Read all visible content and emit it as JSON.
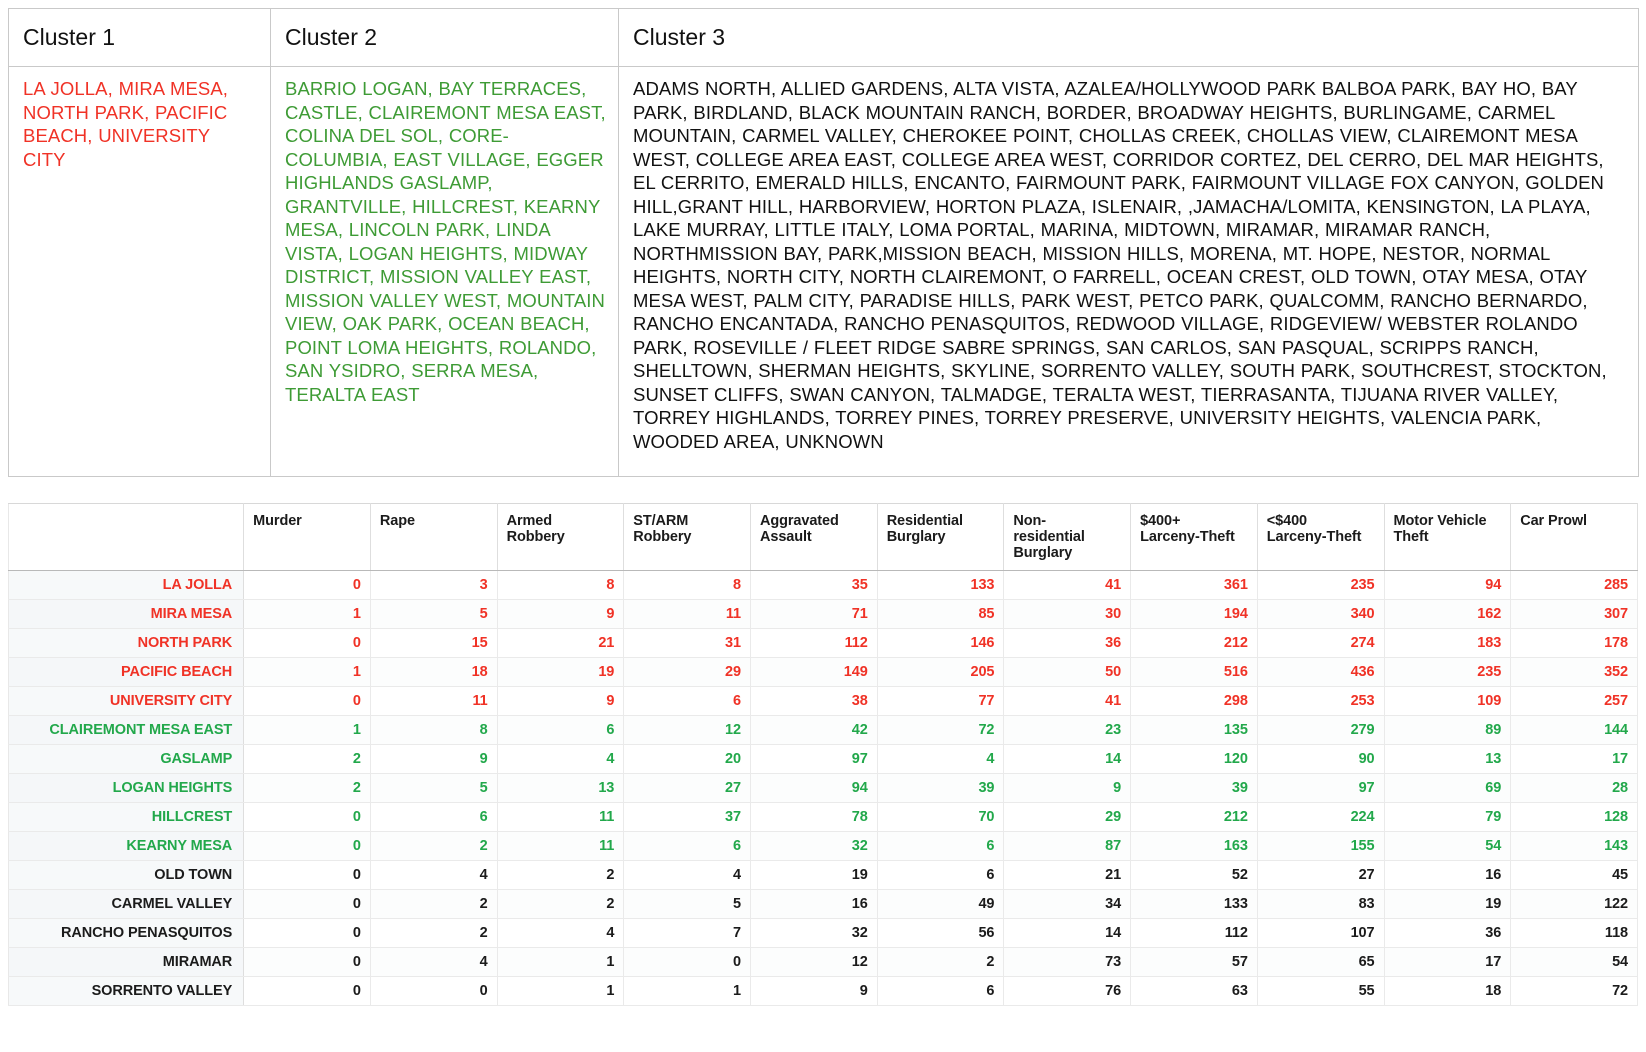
{
  "clusters": {
    "headers": [
      "Cluster 1",
      "Cluster 2",
      "Cluster 3"
    ],
    "colors": {
      "cluster1": "#F03226",
      "cluster2": "#3E9B35",
      "cluster3": "#111111"
    },
    "cluster1_text": "LA JOLLA, MIRA MESA, NORTH PARK, PACIFIC BEACH, UNIVERSITY CITY",
    "cluster2_text": "BARRIO LOGAN, BAY TERRACES, CASTLE,  CLAIREMONT MESA EAST, COLINA DEL SOL, CORE-COLUMBIA, EAST VILLAGE, EGGER HIGHLANDS GASLAMP, GRANTVILLE,  HILLCREST, KEARNY MESA,  LINCOLN PARK, LINDA VISTA,  LOGAN HEIGHTS, MIDWAY DISTRICT, MISSION VALLEY EAST,  MISSION VALLEY WEST,  MOUNTAIN VIEW, OAK PARK, OCEAN BEACH,  POINT LOMA HEIGHTS,  ROLANDO, SAN YSIDRO, SERRA MESA, TERALTA EAST",
    "cluster3_text": "ADAMS NORTH, ALLIED GARDENS,  ALTA VISTA, AZALEA/HOLLYWOOD PARK BALBOA PARK, BAY HO, BAY PARK, BIRDLAND,  BLACK MOUNTAIN RANCH, BORDER,  BROADWAY HEIGHTS, BURLINGAME, CARMEL MOUNTAIN, CARMEL VALLEY, CHEROKEE POINT,  CHOLLAS CREEK, CHOLLAS VIEW, CLAIREMONT MESA WEST, COLLEGE AREA EAST,  COLLEGE AREA WEST, CORRIDOR CORTEZ,  DEL CERRO,  DEL MAR HEIGHTS, EL CERRITO, EMERALD HILLS, ENCANTO, FAIRMOUNT PARK, FAIRMOUNT VILLAGE  FOX CANYON, GOLDEN HILL,GRANT HILL, HARBORVIEW, HORTON PLAZA, ISLENAIR, ,JAMACHA/LOMITA, KENSINGTON, LA PLAYA, LAKE MURRAY, LITTLE ITALY, LOMA PORTAL, MARINA, MIDTOWN, MIRAMAR, MIRAMAR RANCH, NORTHMISSION BAY, PARK,MISSION BEACH, MISSION HILLS, MORENA,  MT. HOPE, NESTOR, NORMAL HEIGHTS, NORTH CITY, NORTH CLAIREMONT, O FARRELL, OCEAN CREST, OLD TOWN, OTAY MESA, OTAY MESA WEST,  PALM CITY, PARADISE HILLS, PARK WEST,  PETCO PARK, QUALCOMM, RANCHO BERNARDO, RANCHO ENCANTADA, RANCHO PENASQUITOS, REDWOOD VILLAGE, RIDGEVIEW/ WEBSTER  ROLANDO PARK, ROSEVILLE / FLEET RIDGE SABRE SPRINGS, SAN CARLOS, SAN PASQUAL, SCRIPPS RANCH, SHELLTOWN, SHERMAN HEIGHTS, SKYLINE, SORRENTO VALLEY, SOUTH PARK, SOUTHCREST, STOCKTON, SUNSET CLIFFS, SWAN CANYON, TALMADGE, TERALTA WEST,   TIERRASANTA, TIJUANA RIVER VALLEY, TORREY HIGHLANDS, TORREY PINES, TORREY PRESERVE, UNIVERSITY HEIGHTS, VALENCIA PARK, WOODED AREA, UNKNOWN"
  },
  "chart_data": {
    "type": "table",
    "title": "",
    "row_header_label": "",
    "categories": [
      "Murder",
      "Rape",
      "Armed Robbery",
      "ST/ARM Robbery",
      "Aggravated Assault",
      "Residential Burglary",
      "Non-residential Burglary",
      "$400+ Larceny-Theft",
      "<$400 Larceny-Theft",
      "Motor Vehicle Theft",
      "Car Prowl"
    ],
    "column_headers": [
      {
        "line1": "",
        "line2": "",
        "line3": ""
      },
      {
        "line1": "Murder",
        "line2": "",
        "line3": ""
      },
      {
        "line1": "Rape",
        "line2": "",
        "line3": ""
      },
      {
        "line1": "Armed",
        "line2": "Robbery",
        "line3": ""
      },
      {
        "line1": "ST/ARM",
        "line2": "Robbery",
        "line3": ""
      },
      {
        "line1": "Aggravated",
        "line2": "Assault",
        "line3": ""
      },
      {
        "line1": "Residential",
        "line2": "Burglary",
        "line3": ""
      },
      {
        "line1": "Non-",
        "line2": "residential",
        "line3": "Burglary"
      },
      {
        "line1": "$400+",
        "line2": "Larceny-Theft",
        "line3": ""
      },
      {
        "line1": "<$400",
        "line2": "Larceny-Theft",
        "line3": ""
      },
      {
        "line1": "Motor Vehicle",
        "line2": "Theft",
        "line3": ""
      },
      {
        "line1": "Car Prowl",
        "line2": "",
        "line3": ""
      }
    ],
    "colors": {
      "cluster1": "#F03226",
      "cluster2": "#22A84B",
      "cluster3": "#1b1b1b"
    },
    "rows": [
      {
        "name": "LA JOLLA",
        "color": "red",
        "values": [
          0,
          3,
          8,
          8,
          35,
          133,
          41,
          361,
          235,
          94,
          285
        ]
      },
      {
        "name": "MIRA MESA",
        "color": "red",
        "values": [
          1,
          5,
          9,
          11,
          71,
          85,
          30,
          194,
          340,
          162,
          307
        ]
      },
      {
        "name": "NORTH PARK",
        "color": "red",
        "values": [
          0,
          15,
          21,
          31,
          112,
          146,
          36,
          212,
          274,
          183,
          178
        ]
      },
      {
        "name": "PACIFIC BEACH",
        "color": "red",
        "values": [
          1,
          18,
          19,
          29,
          149,
          205,
          50,
          516,
          436,
          235,
          352
        ]
      },
      {
        "name": "UNIVERSITY CITY",
        "color": "red",
        "values": [
          0,
          11,
          9,
          6,
          38,
          77,
          41,
          298,
          253,
          109,
          257
        ]
      },
      {
        "name": "CLAIREMONT MESA EAST",
        "color": "green",
        "values": [
          1,
          8,
          6,
          12,
          42,
          72,
          23,
          135,
          279,
          89,
          144
        ]
      },
      {
        "name": "GASLAMP",
        "color": "green",
        "values": [
          2,
          9,
          4,
          20,
          97,
          4,
          14,
          120,
          90,
          13,
          17
        ]
      },
      {
        "name": "LOGAN HEIGHTS",
        "color": "green",
        "values": [
          2,
          5,
          13,
          27,
          94,
          39,
          9,
          39,
          97,
          69,
          28
        ]
      },
      {
        "name": "HILLCREST",
        "color": "green",
        "values": [
          0,
          6,
          11,
          37,
          78,
          70,
          29,
          212,
          224,
          79,
          128
        ]
      },
      {
        "name": "KEARNY MESA",
        "color": "green",
        "values": [
          0,
          2,
          11,
          6,
          32,
          6,
          87,
          163,
          155,
          54,
          143
        ]
      },
      {
        "name": "OLD TOWN",
        "color": "black",
        "values": [
          0,
          4,
          2,
          4,
          19,
          6,
          21,
          52,
          27,
          16,
          45
        ]
      },
      {
        "name": "CARMEL VALLEY",
        "color": "black",
        "values": [
          0,
          2,
          2,
          5,
          16,
          49,
          34,
          133,
          83,
          19,
          122
        ]
      },
      {
        "name": "RANCHO PENASQUITOS",
        "color": "black",
        "values": [
          0,
          2,
          4,
          7,
          32,
          56,
          14,
          112,
          107,
          36,
          118
        ]
      },
      {
        "name": "MIRAMAR",
        "color": "black",
        "values": [
          0,
          4,
          1,
          0,
          12,
          2,
          73,
          57,
          65,
          17,
          54
        ]
      },
      {
        "name": "SORRENTO VALLEY",
        "color": "black",
        "values": [
          0,
          0,
          1,
          1,
          9,
          6,
          76,
          63,
          55,
          18,
          72
        ]
      }
    ]
  }
}
